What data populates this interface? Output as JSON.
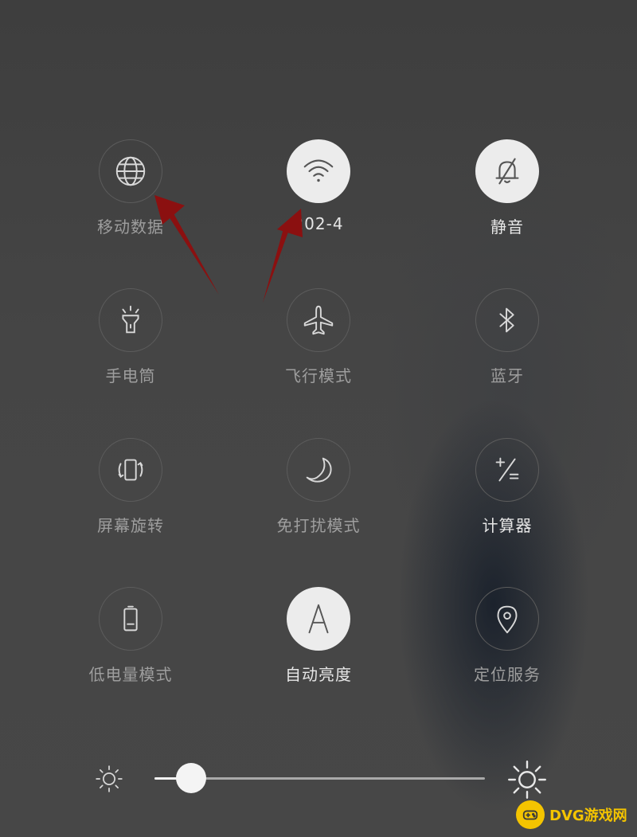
{
  "tiles": [
    {
      "label": "移动数据",
      "icon": "globe-icon",
      "on": false
    },
    {
      "label": "202-4",
      "icon": "wifi-icon",
      "on": true
    },
    {
      "label": "静音",
      "icon": "bell-mute-icon",
      "on": true
    },
    {
      "label": "手电筒",
      "icon": "flashlight-icon",
      "on": false
    },
    {
      "label": "飞行模式",
      "icon": "airplane-icon",
      "on": false
    },
    {
      "label": "蓝牙",
      "icon": "bluetooth-icon",
      "on": false
    },
    {
      "label": "屏幕旋转",
      "icon": "rotate-icon",
      "on": false
    },
    {
      "label": "免打扰模式",
      "icon": "moon-icon",
      "on": false
    },
    {
      "label": "计算器",
      "icon": "calculator-icon",
      "on": false
    },
    {
      "label": "低电量模式",
      "icon": "battery-icon",
      "on": false
    },
    {
      "label": "自动亮度",
      "icon": "auto-brightness-icon",
      "on": true
    },
    {
      "label": "定位服务",
      "icon": "location-icon",
      "on": false
    }
  ],
  "brightness": {
    "level": 0.11
  },
  "watermark": {
    "text": "DVG游戏网"
  },
  "colors": {
    "accent_arrow": "#8b1010",
    "watermark": "#f4c400"
  }
}
